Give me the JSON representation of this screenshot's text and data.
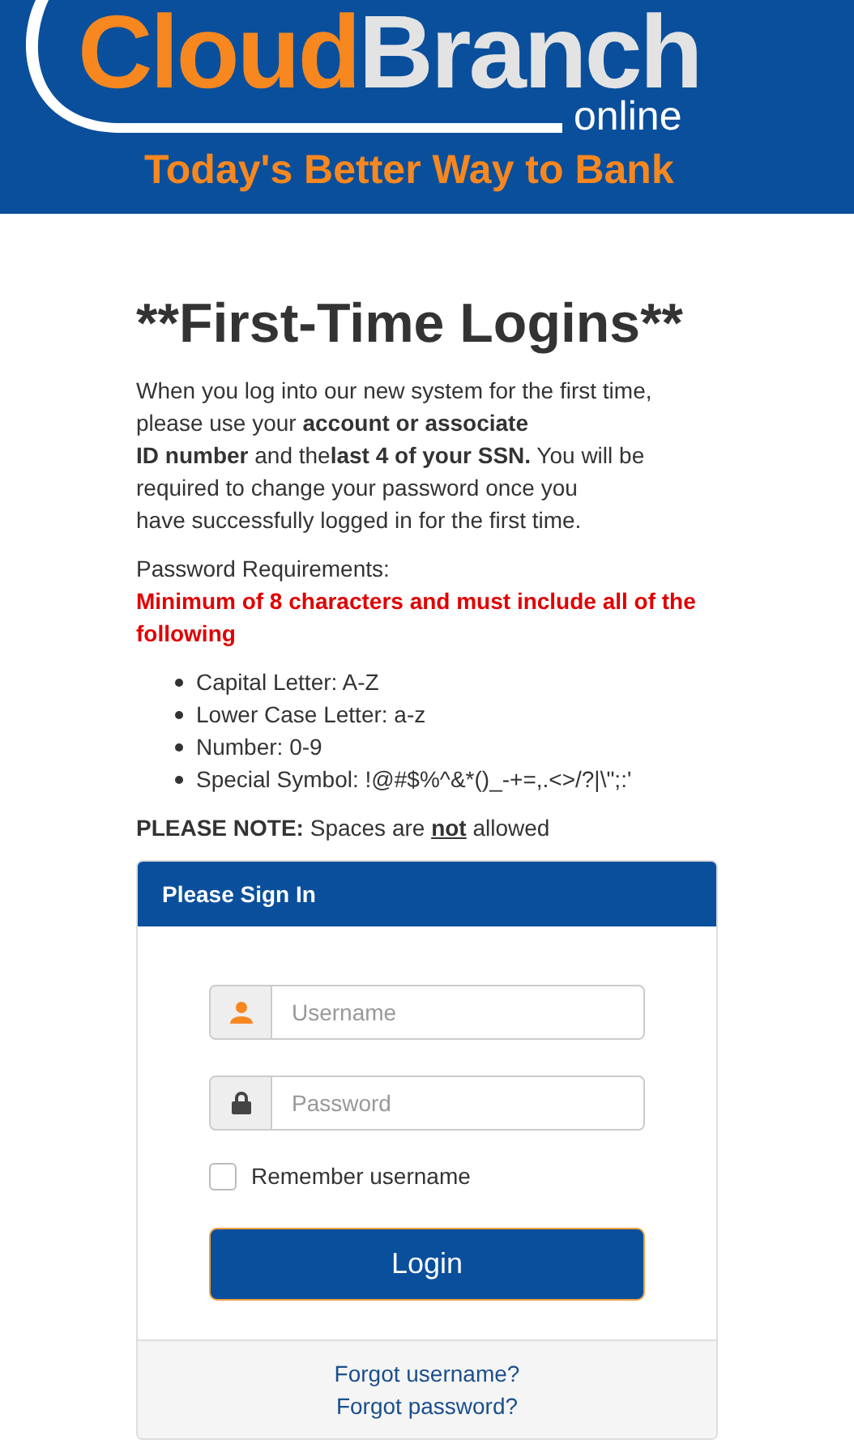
{
  "header": {
    "logo": {
      "part_1": "Cloud",
      "part_2": "Branch",
      "part_3": "online"
    },
    "tagline": "Today's Better Way to Bank"
  },
  "title": "**First-Time Logins**",
  "intro": "When you log into our new system for the first time,\nplease use your **account or associate**\n**ID number** and the**last 4 of your SSN.** You will be\nrequired to change your password once you\nhave successfully logged in for the first time.",
  "requirements": {
    "heading": "Password Requirements:",
    "warning": "Minimum of 8 characters and must include all of the following",
    "items": [
      "Capital Letter: A-Z",
      "Lower Case Letter: a-z",
      "Number: 0-9",
      "Special Symbol: !@#$%^&*()_-+=,.<>/?|\\\";:'"
    ]
  },
  "note": {
    "label": "PLEASE NOTE:",
    "before": "Spaces are",
    "emphasis": "not",
    "after": "allowed"
  },
  "signin": {
    "title": "Please Sign In",
    "fields": [
      {
        "kind": "user",
        "placeholder": "Username"
      },
      {
        "kind": "lock",
        "placeholder": "Password"
      }
    ],
    "remember": {
      "label": "Remember username",
      "checked": false
    },
    "button": "Login",
    "links": [
      "Forgot username?",
      "Forgot password?"
    ]
  }
}
